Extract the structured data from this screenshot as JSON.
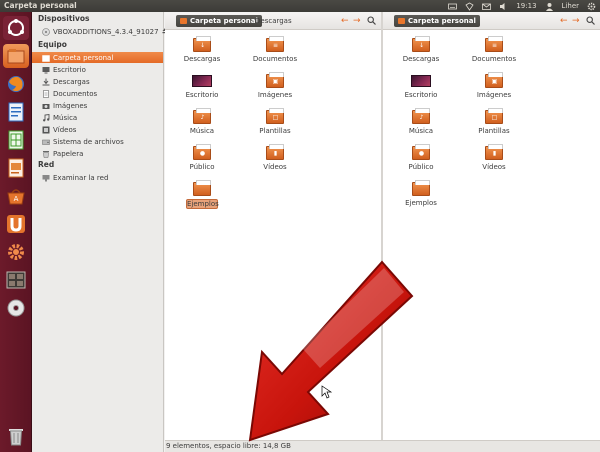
{
  "window": {
    "title": "Carpeta personal"
  },
  "tray": {
    "time": "19:13",
    "user": "Liher"
  },
  "launcher": {
    "items": [
      "dash-icon",
      "files-icon",
      "firefox-icon",
      "writer-icon",
      "calc-icon",
      "impress-icon",
      "software-center-icon",
      "ubuntu-one-icon",
      "system-settings-icon",
      "workspaces-icon",
      "dvd-icon",
      "trash-icon"
    ]
  },
  "sidebar": {
    "devices_header": "Dispositivos",
    "devices": [
      {
        "label": "VBOXADDITIONS_4.3.4_91027"
      }
    ],
    "computer_header": "Equipo",
    "computer": [
      {
        "label": "Carpeta personal"
      },
      {
        "label": "Escritorio"
      },
      {
        "label": "Descargas"
      },
      {
        "label": "Documentos"
      },
      {
        "label": "Imágenes"
      },
      {
        "label": "Música"
      },
      {
        "label": "Vídeos"
      },
      {
        "label": "Sistema de archivos"
      },
      {
        "label": "Papelera"
      }
    ],
    "network_header": "Red",
    "network": [
      {
        "label": "Examinar la red"
      }
    ]
  },
  "left_pane": {
    "breadcrumb_active": "Carpeta personal",
    "breadcrumb_next": "Descargas",
    "files": [
      {
        "label": "Descargas",
        "type": "folder"
      },
      {
        "label": "Documentos",
        "type": "folder"
      },
      {
        "label": "Escritorio",
        "type": "desktop"
      },
      {
        "label": "Imágenes",
        "type": "folder"
      },
      {
        "label": "Música",
        "type": "folder"
      },
      {
        "label": "Plantillas",
        "type": "folder"
      },
      {
        "label": "Público",
        "type": "folder"
      },
      {
        "label": "Vídeos",
        "type": "folder"
      },
      {
        "label": "Ejemplos",
        "type": "folder"
      }
    ]
  },
  "right_pane": {
    "breadcrumb_active": "Carpeta personal",
    "files": [
      {
        "label": "Descargas",
        "type": "folder"
      },
      {
        "label": "Documentos",
        "type": "folder"
      },
      {
        "label": "Escritorio",
        "type": "desktop"
      },
      {
        "label": "Imágenes",
        "type": "folder"
      },
      {
        "label": "Música",
        "type": "folder"
      },
      {
        "label": "Plantillas",
        "type": "folder"
      },
      {
        "label": "Público",
        "type": "folder"
      },
      {
        "label": "Vídeos",
        "type": "folder"
      },
      {
        "label": "Ejemplos",
        "type": "folder"
      }
    ]
  },
  "status": {
    "text": "9 elementos, espacio libre: 14,8 GB"
  },
  "colors": {
    "accent": "#e46a26",
    "launcher": "#5b1423",
    "panel": "#3c3b37",
    "arrow": "#c8140c"
  }
}
